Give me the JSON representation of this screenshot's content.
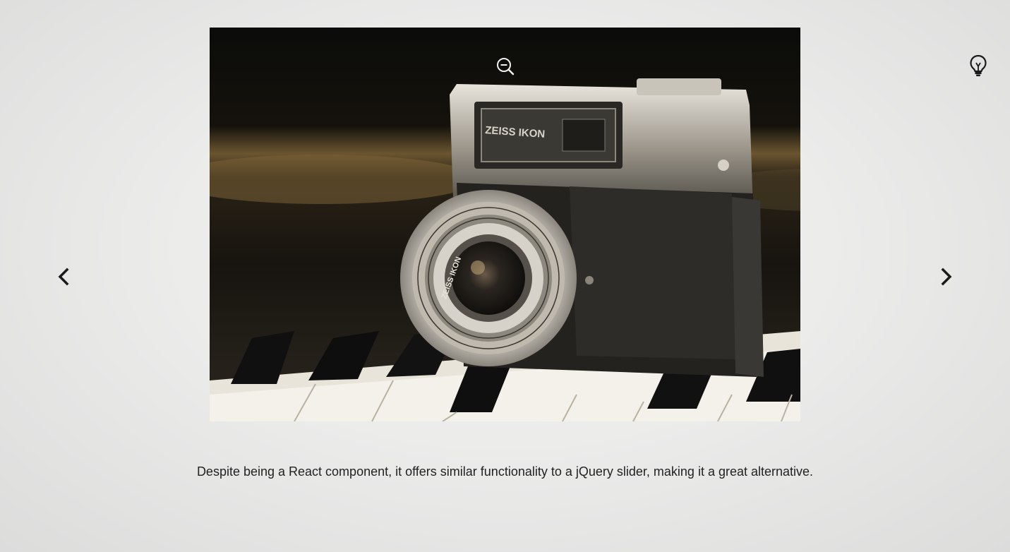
{
  "lightbox": {
    "caption": "Despite being a React component, it offers similar functionality to a jQuery slider, making it a great alternative.",
    "image": {
      "subject": "vintage camera resting on piano keys",
      "lens_text": "ZEISS IKON",
      "body_text": "ZEISS IKON"
    },
    "controls": {
      "zoom_icon": "zoom-out-icon",
      "theme_icon": "lightbulb-icon",
      "prev_icon": "chevron-left-icon",
      "next_icon": "chevron-right-icon"
    },
    "colors": {
      "background": "#ececeb",
      "icon": "#1a1a1a",
      "caption": "#222222"
    }
  }
}
